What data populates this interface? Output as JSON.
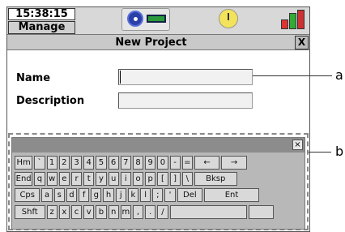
{
  "status_bar": {
    "time": "15:38:15",
    "menu": "Manage"
  },
  "window": {
    "title": "New Project",
    "close_label": "X"
  },
  "form": {
    "name_label": "Name",
    "name_value": "",
    "description_label": "Description",
    "description_value": ""
  },
  "callouts": {
    "a": "a",
    "b": "b"
  },
  "keyboard": {
    "close_label": "×",
    "rows": [
      [
        "Hm",
        "`",
        "1",
        "2",
        "3",
        "4",
        "5",
        "6",
        "7",
        "8",
        "9",
        "0",
        "-",
        "=",
        "←",
        "→"
      ],
      [
        "End",
        "q",
        "w",
        "e",
        "r",
        "t",
        "y",
        "u",
        "i",
        "o",
        "p",
        "[",
        "]",
        "\\",
        "Bksp"
      ],
      [
        "Cps",
        "a",
        "s",
        "d",
        "f",
        "g",
        "h",
        "j",
        "k",
        "l",
        ";",
        "'",
        "Del",
        "Ent"
      ],
      [
        "Shft",
        "z",
        "x",
        "c",
        "v",
        "b",
        "n",
        "m",
        ",",
        ".",
        "/",
        "",
        ""
      ]
    ]
  },
  "icons": [
    "disc-icon",
    "memory-card-icon",
    "clock-icon",
    "battery-icon"
  ]
}
